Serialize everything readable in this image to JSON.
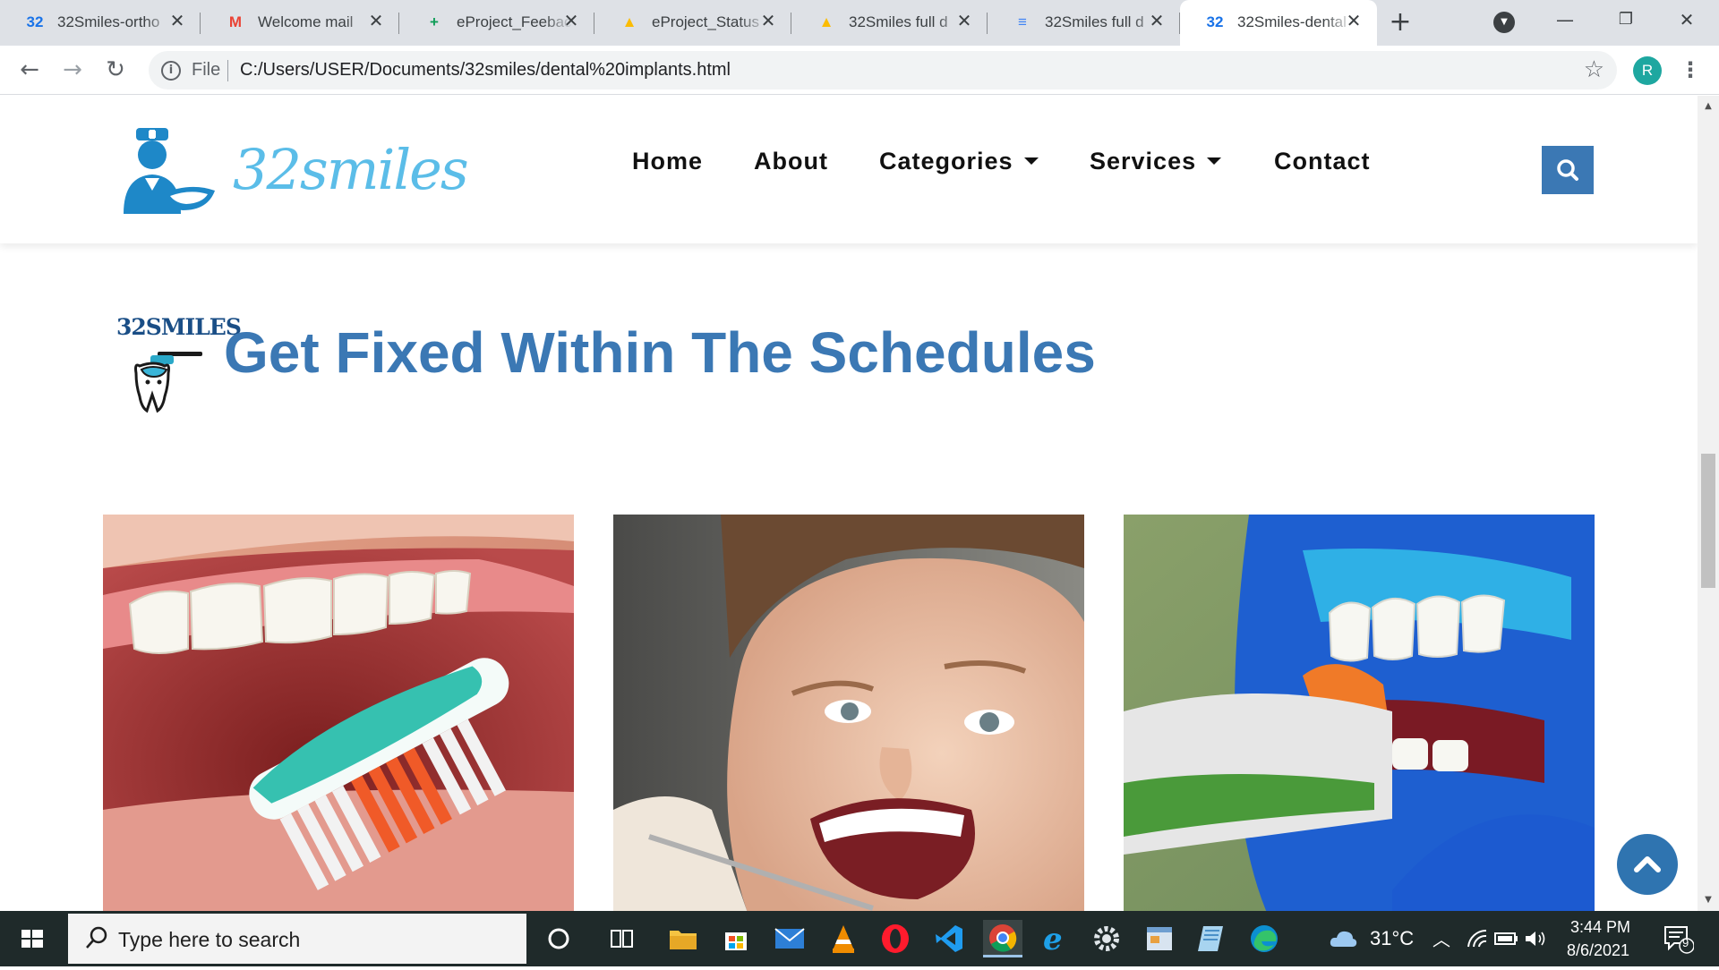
{
  "browser": {
    "tabs": [
      {
        "title": "32Smiles-ortho",
        "favicon_text": "32",
        "favicon_color": "#1a73e8",
        "active": false
      },
      {
        "title": "Welcome mail",
        "favicon_text": "M",
        "favicon_color": "#ea4335",
        "active": false
      },
      {
        "title": "eProject_Feeback",
        "favicon_text": "+",
        "favicon_color": "#0f9d58",
        "active": false
      },
      {
        "title": "eProject_Status",
        "favicon_text": "▲",
        "favicon_color": "#fbbc04",
        "active": false
      },
      {
        "title": "32Smiles full d",
        "favicon_text": "▲",
        "favicon_color": "#fbbc04",
        "active": false
      },
      {
        "title": "32Smiles full d",
        "favicon_text": "≡",
        "favicon_color": "#4285f4",
        "active": false
      },
      {
        "title": "32Smiles-dental",
        "favicon_text": "32",
        "favicon_color": "#1a73e8",
        "active": true
      }
    ],
    "tab_close_glyph": "✕",
    "new_tab_glyph": "+",
    "scheme_label": "File",
    "url": "C:/Users/USER/Documents/32smiles/dental%20implants.html",
    "profile_initial": "R"
  },
  "site": {
    "logo_text": "32smiles",
    "nav": {
      "home": "Home",
      "about": "About",
      "categories": "Categories",
      "services": "Services",
      "contact": "Contact"
    },
    "section_badge_text": "32SMILES",
    "section_title": "Get Fixed Within The Schedules",
    "cards": [
      {
        "image": "toothbrush-with-toothpaste-photo"
      },
      {
        "image": "girl-at-dentist-photo"
      },
      {
        "image": "teeth-whitening-curing-light-photo"
      }
    ],
    "colors": {
      "accent": "#3b78b4",
      "logo": "#5bbde8"
    }
  },
  "taskbar": {
    "search_placeholder": "Type here to search",
    "weather": "31°C",
    "time": "3:44 PM",
    "date": "8/6/2021",
    "notification_count": "9"
  }
}
